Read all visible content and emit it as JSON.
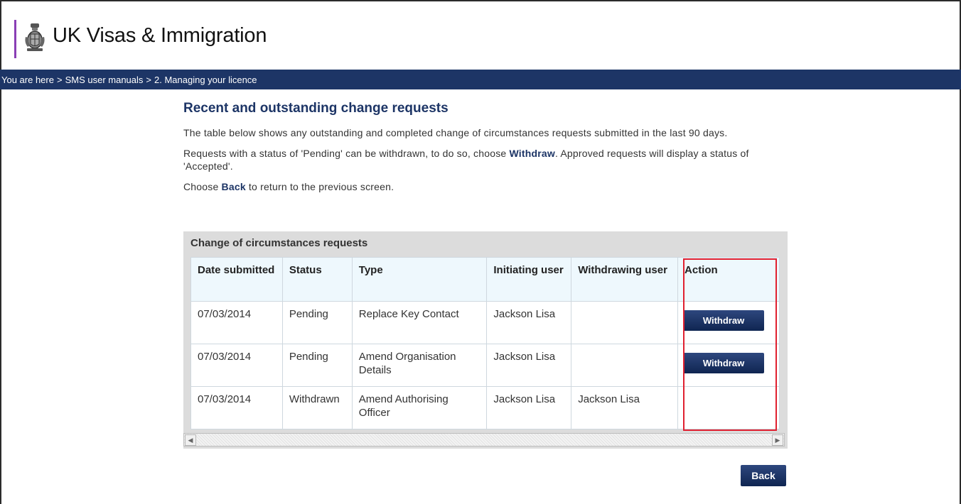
{
  "header": {
    "title": "UK Visas & Immigration",
    "crest_icon": "royal-crest-icon",
    "brand_color": "#8a3fb5"
  },
  "breadcrumb": {
    "prefix": "You are here",
    "items": [
      "SMS user manuals",
      "2. Managing your licence"
    ],
    "separator": ">"
  },
  "content": {
    "heading": "Recent and outstanding change requests",
    "para1": "The table below shows any outstanding and completed change of circumstances requests submitted in the last 90 days.",
    "para2_pre": "Requests with a status of 'Pending' can be withdrawn, to do so, choose ",
    "para2_bold": "Withdraw",
    "para2_post": ". Approved requests will display a status of 'Accepted'.",
    "para3_pre": "Choose ",
    "para3_bold": "Back",
    "para3_post": " to return to the previous screen."
  },
  "table": {
    "title": "Change of circumstances requests",
    "columns": [
      "Date submitted",
      "Status",
      "Type",
      "Initiating user",
      "Withdrawing user",
      "Action"
    ],
    "rows": [
      {
        "date": "07/03/2014",
        "status": "Pending",
        "type": "Replace Key Contact",
        "initiating": "Jackson Lisa",
        "withdrawing": "",
        "action": "Withdraw"
      },
      {
        "date": "07/03/2014",
        "status": "Pending",
        "type": "Amend Organisation Details",
        "initiating": "Jackson Lisa",
        "withdrawing": "",
        "action": "Withdraw"
      },
      {
        "date": "07/03/2014",
        "status": "Withdrawn",
        "type": "Amend Authorising Officer",
        "initiating": "Jackson Lisa",
        "withdrawing": "Jackson Lisa",
        "action": ""
      }
    ]
  },
  "buttons": {
    "back": "Back"
  },
  "colors": {
    "navy": "#1d3566",
    "highlight": "#e02030",
    "header_row": "#eef8fd"
  }
}
